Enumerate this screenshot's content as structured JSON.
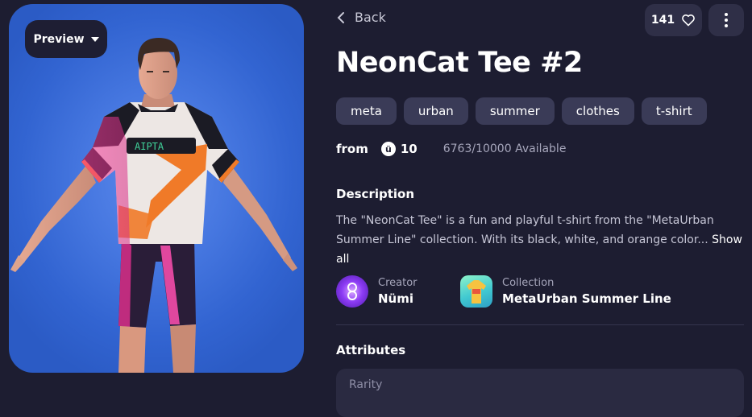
{
  "preview": {
    "label": "Preview"
  },
  "nav": {
    "back_label": "Back"
  },
  "likes": {
    "count": "141"
  },
  "item": {
    "title": "NeonCat Tee #2",
    "tags": [
      "meta",
      "urban",
      "summer",
      "clothes",
      "t-shirt"
    ],
    "price_prefix": "from",
    "currency_symbol": "ü",
    "price": "10",
    "availability": "6763/10000 Available"
  },
  "description": {
    "title": "Description",
    "text": "The \"NeonCat Tee\" is a fun and playful t-shirt from the \"MetaUrban Summer Line\" collection. With its black, white, and orange color...",
    "show_all_label": "Show all"
  },
  "creator": {
    "label": "Creator",
    "name": "Nümi"
  },
  "collection": {
    "label": "Collection",
    "name": "MetaUrban Summer Line"
  },
  "attributes": {
    "title": "Attributes",
    "first_label": "Rarity"
  },
  "colors": {
    "background": "#1d1d31",
    "chip": "#3a3b57",
    "preview_bg": "#3f6fdb"
  }
}
